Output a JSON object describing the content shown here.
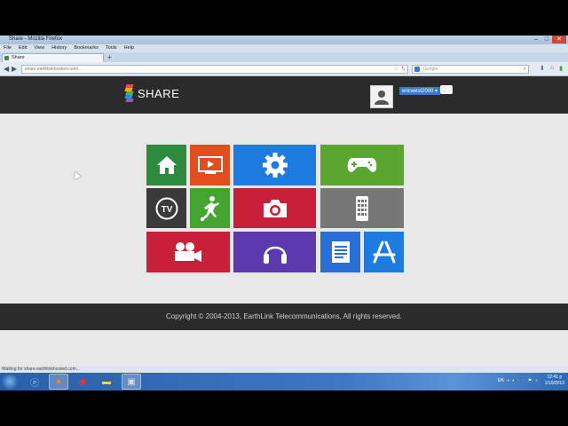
{
  "window": {
    "title": "Share - Mozilla Firefox",
    "controls": {
      "minimize": "–",
      "maximize": "□",
      "close": "✕"
    }
  },
  "menu": [
    "File",
    "Edit",
    "View",
    "History",
    "Bookmarks",
    "Tools",
    "Help"
  ],
  "tab": {
    "label": "Share",
    "new_tab": "+"
  },
  "nav": {
    "url": "share.earthlinkhosted.com/...",
    "search_placeholder": "Google"
  },
  "header": {
    "logo_text": "SHARE",
    "username": "ericwest2000 ▾"
  },
  "tiles": [
    {
      "name": "home",
      "icon": "home-icon",
      "color": "#2e8b3e"
    },
    {
      "name": "video",
      "icon": "play-icon",
      "color": "#e0501f"
    },
    {
      "name": "settings",
      "icon": "gear-icon",
      "color": "#1e7be0"
    },
    {
      "name": "games",
      "icon": "gamepad-icon",
      "color": "#5aa631"
    },
    {
      "name": "tv",
      "icon": "tv-icon",
      "color": "#3a3a3a"
    },
    {
      "name": "sports",
      "icon": "soccer-player-icon",
      "color": "#45a42f"
    },
    {
      "name": "photos",
      "icon": "camera-icon",
      "color": "#c8203a"
    },
    {
      "name": "mobile",
      "icon": "phone-icon",
      "color": "#777777"
    },
    {
      "name": "movies",
      "icon": "video-camera-icon",
      "color": "#c8203a"
    },
    {
      "name": "music",
      "icon": "headphones-icon",
      "color": "#5b3aad"
    },
    {
      "name": "documents",
      "icon": "document-icon",
      "color": "#2a6fd6"
    },
    {
      "name": "apps",
      "icon": "app-store-icon",
      "color": "#1e7be0"
    }
  ],
  "footer": {
    "copyright": "Copyright © 2004-2013, EarthLink Telecommunications, All rights reserved."
  },
  "status": {
    "text": "Waiting for share.earthlinkhosted.com..."
  },
  "taskbar": {
    "clock_time": "12:41 p",
    "clock_date": "1/10/2013",
    "tray_lang": "EN"
  }
}
